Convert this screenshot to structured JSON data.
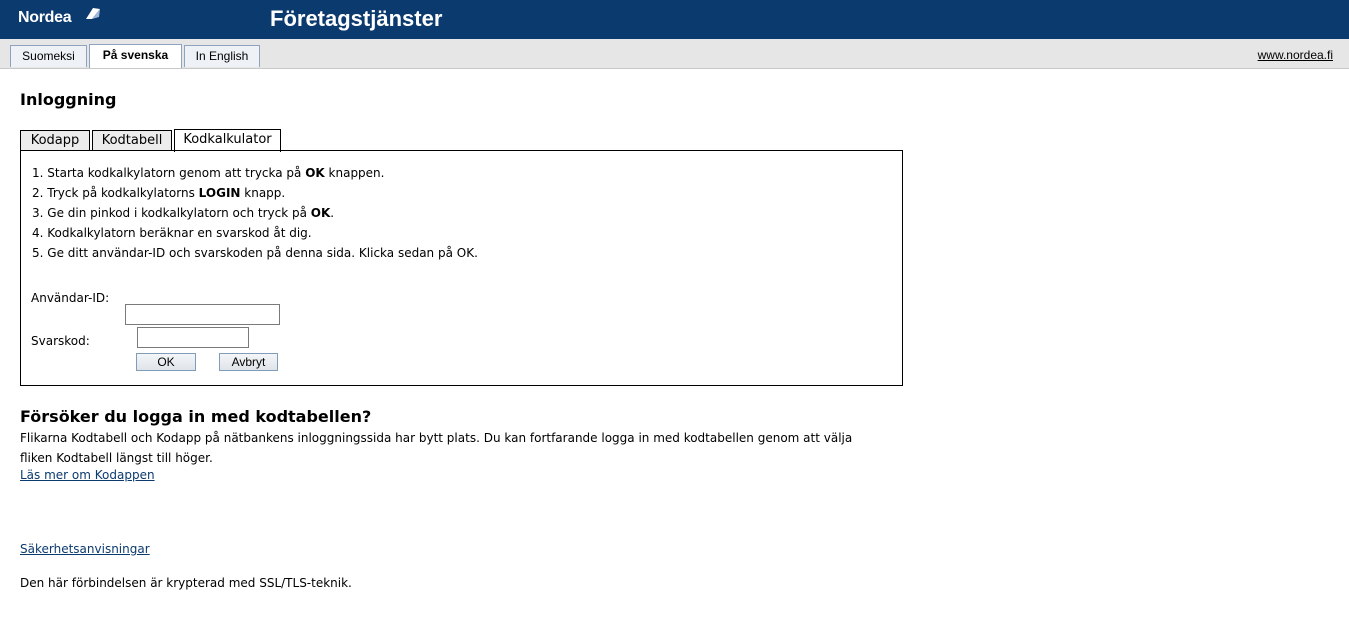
{
  "header": {
    "logo_text": "Nordea",
    "title": "Företagstjänster"
  },
  "languages": {
    "tabs": [
      {
        "label": "Suomeksi"
      },
      {
        "label": "På svenska"
      },
      {
        "label": "In English"
      }
    ],
    "active": "På svenska",
    "site_link": "www.nordea.fi"
  },
  "login": {
    "heading": "Inloggning",
    "tabs": [
      {
        "label": "Kodapp"
      },
      {
        "label": "Kodtabell"
      },
      {
        "label": "Kodkalkulator"
      }
    ],
    "active_tab": "Kodkalkulator",
    "steps": [
      {
        "pre": "1. Starta kodkalkylatorn genom att trycka på ",
        "bold": "OK",
        "post": " knappen."
      },
      {
        "pre": "2. Tryck på kodkalkylatorns ",
        "bold": "LOGIN",
        "post": " knapp."
      },
      {
        "pre": "3. Ge din pinkod i kodkalkylatorn och tryck på ",
        "bold": "OK",
        "post": "."
      },
      {
        "pre": "4. Kodkalkylatorn beräknar en svarskod åt dig.",
        "bold": "",
        "post": ""
      },
      {
        "pre": "5. Ge ditt användar-ID och svarskoden på denna sida. Klicka sedan på OK.",
        "bold": "",
        "post": ""
      }
    ],
    "user_id_label": "Användar-ID:",
    "user_id_value": "",
    "response_label": "Svarskod:",
    "response_value": "",
    "ok_label": "OK",
    "cancel_label": "Avbryt"
  },
  "info": {
    "heading": "Försöker du logga in med kodtabellen?",
    "line1": "Flikarna Kodtabell och Kodapp på nätbankens inloggningssida har bytt plats. Du kan fortfarande logga in med kodtabellen genom att välja",
    "line2": "fliken Kodtabell längst till höger.",
    "read_more_link": "Läs mer om Kodappen"
  },
  "footer": {
    "security_link": "Säkerhetsanvisningar",
    "ssl_text": "Den här förbindelsen är krypterad med SSL/TLS-teknik."
  },
  "colors": {
    "header_bg": "#0b3a6e",
    "lang_bar_bg": "#e6e6e6",
    "link": "#0b3a6e"
  },
  "icons": {
    "logo_mark": "nordea-sail-logo-icon"
  }
}
